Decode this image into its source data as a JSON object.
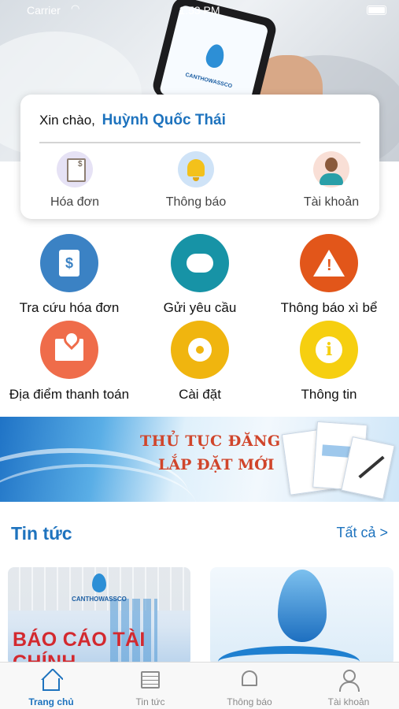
{
  "status_bar": {
    "carrier": "Carrier",
    "time": "1:53 PM"
  },
  "hero": {
    "brand": "CANTHOWASSCO"
  },
  "greeting": {
    "prefix": "Xin chào,",
    "name": "Huỳnh Quốc Thái"
  },
  "quick_actions": [
    {
      "label": "Hóa đơn",
      "icon": "invoice-icon"
    },
    {
      "label": "Thông báo",
      "icon": "bell-icon"
    },
    {
      "label": "Tài khoản",
      "icon": "avatar-icon"
    }
  ],
  "menu": [
    {
      "label": "Tra cứu hóa đơn",
      "icon": "invoice-lookup-icon",
      "color": "#3b82c4"
    },
    {
      "label": "Gửi yêu cầu",
      "icon": "chat-bubbles-icon",
      "color": "#1793a6"
    },
    {
      "label": "Thông báo xì bể",
      "icon": "warning-icon",
      "color": "#e2561a"
    },
    {
      "label": "Địa điểm thanh toán",
      "icon": "map-pin-icon",
      "color": "#ef6c4a"
    },
    {
      "label": "Cài đặt",
      "icon": "gear-icon",
      "color": "#f0b50f"
    },
    {
      "label": "Thông tin",
      "icon": "info-icon",
      "color": "#f6cf10"
    }
  ],
  "banner": {
    "line1": "THỦ TỤC ĐĂNG KÝ",
    "line2": "LẮP ĐẶT MỚI"
  },
  "news": {
    "title": "Tin tức",
    "see_all": "Tất cả >",
    "cards": [
      {
        "brand": "CANTHOWASSCO",
        "headline": "BÁO CÁO TÀI CHÍNH"
      },
      {
        "headline": ""
      }
    ]
  },
  "tabbar": [
    {
      "label": "Trang chủ",
      "icon": "home-icon",
      "active": true
    },
    {
      "label": "Tin tức",
      "icon": "newspaper-icon",
      "active": false
    },
    {
      "label": "Thông báo",
      "icon": "bell-icon",
      "active": false
    },
    {
      "label": "Tài khoản",
      "icon": "person-icon",
      "active": false
    }
  ],
  "colors": {
    "accent": "#1e73be"
  }
}
